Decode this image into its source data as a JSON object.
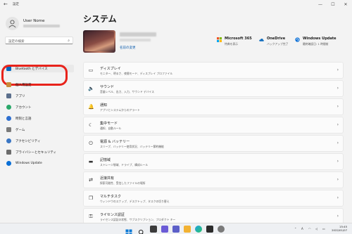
{
  "window": {
    "back_label": "←",
    "title": "設定",
    "minimize": "—",
    "maximize": "☐",
    "close": "✕"
  },
  "sidebar": {
    "user_name": "User Nome",
    "search_placeholder": "設定の検索",
    "items": [
      {
        "label": "Bluetooth とデバイス",
        "icon": "bluetooth-icon",
        "color": "#0067c0"
      },
      {
        "label": "個人用設定",
        "icon": "brush-icon",
        "color": "#c98a3a"
      },
      {
        "label": "アプリ",
        "icon": "apps-icon",
        "color": "#5b6f8c"
      },
      {
        "label": "アカウント",
        "icon": "account-icon",
        "color": "#2aa86a"
      },
      {
        "label": "時刻と言語",
        "icon": "globe-clock-icon",
        "color": "#2e6fd0"
      },
      {
        "label": "ゲーム",
        "icon": "gamepad-icon",
        "color": "#7a7a7a"
      },
      {
        "label": "アクセシビリティ",
        "icon": "accessibility-icon",
        "color": "#3a76c4"
      },
      {
        "label": "プライバシーとセキュリティ",
        "icon": "shield-icon",
        "color": "#6c6c6c"
      },
      {
        "label": "Windows Update",
        "icon": "update-icon",
        "color": "#0a6fd6"
      }
    ]
  },
  "main": {
    "title": "システム",
    "device": {
      "rename_label": "名前の変更"
    },
    "quick": [
      {
        "title": "Microsoft 365",
        "subtitle": "特典を表示",
        "icon": "microsoft-logo-icon"
      },
      {
        "title": "OneDrive",
        "subtitle": "バックアップ完了",
        "icon": "cloud-icon"
      },
      {
        "title": "Windows Update",
        "subtitle": "最終確認日: 1 時間前",
        "icon": "update-icon"
      }
    ],
    "rows": [
      {
        "title": "ディスプレイ",
        "subtitle": "モニター、明るさ、夜間モード、ディスプレイ プロファイル",
        "icon": "display-icon",
        "glyph": "▭"
      },
      {
        "title": "サウンド",
        "subtitle": "音量レベル、出力、入力、サウンド デバイス",
        "icon": "speaker-icon",
        "glyph": "🔈"
      },
      {
        "title": "通知",
        "subtitle": "アプリとシステムからのアラート",
        "icon": "bell-icon",
        "glyph": "🔔"
      },
      {
        "title": "集中モード",
        "subtitle": "通知、自動ルール",
        "icon": "moon-icon",
        "glyph": "☾"
      },
      {
        "title": "電源 & バッテリー",
        "subtitle": "スリープ、バッテリー使用状況、バッテリー節約機能",
        "icon": "power-icon",
        "glyph": "⏻"
      },
      {
        "title": "記憶域",
        "subtitle": "ストレージ領域、ドライブ、構成ルール",
        "icon": "storage-icon",
        "glyph": "▬"
      },
      {
        "title": "近接共有",
        "subtitle": "探索可能性、受信したファイルの場所",
        "icon": "share-icon",
        "glyph": "⇄"
      },
      {
        "title": "マルチタスク",
        "subtitle": "ウィンドウのスナップ、デスクトップ、タスクの切り替え",
        "icon": "multitask-icon",
        "glyph": "❐"
      },
      {
        "title": "ライセンス認証",
        "subtitle": "ライセンス認証の状態、サブスクリプション、プロダクト キー",
        "icon": "key-icon",
        "glyph": "⚿"
      }
    ],
    "chevron": "›"
  },
  "taskbar": {
    "time": "15:45",
    "date": "2022/01/07",
    "lang": "A",
    "accent": "#0067c0"
  }
}
